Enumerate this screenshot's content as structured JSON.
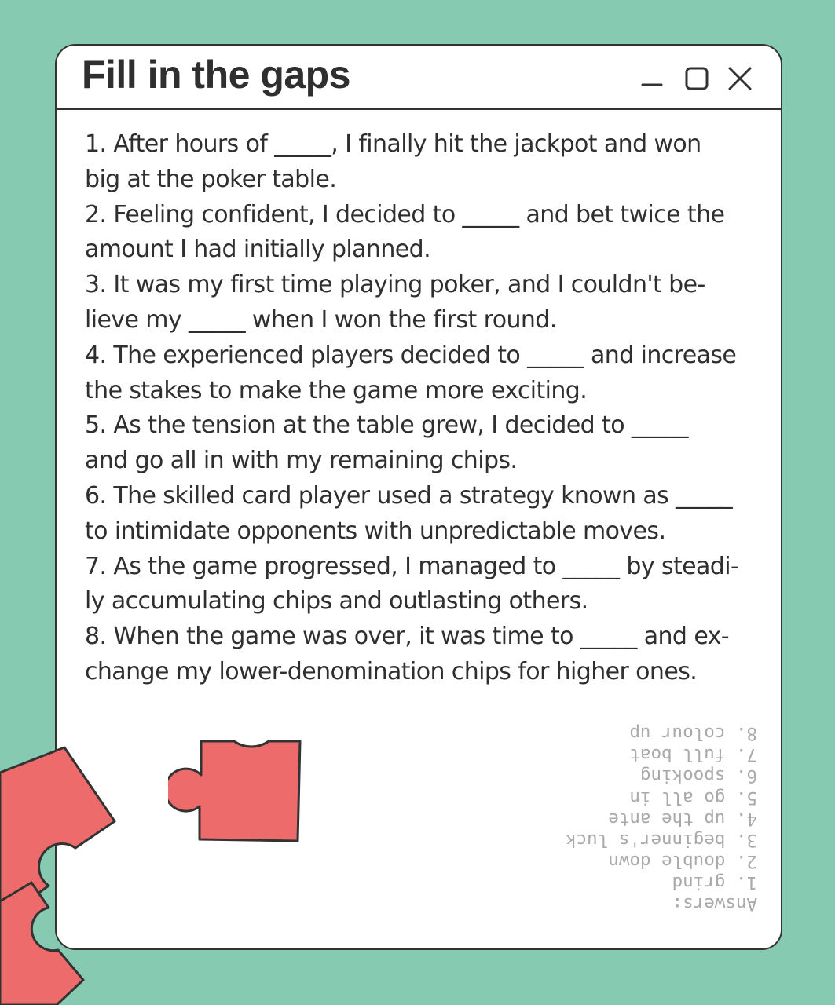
{
  "window": {
    "title": "Fill in the gaps",
    "controls": [
      "minimize-icon",
      "maximize-icon",
      "close-icon"
    ]
  },
  "exercise": {
    "lines": [
      "1. After hours of _____, I finally hit the jackpot and won",
      "big at the poker table.",
      "2. Feeling confident, I decided to _____ and bet twice the",
      "amount I had initially planned.",
      "3. It was my first time playing poker, and I couldn't be-",
      "lieve my _____ when I won the first round.",
      "4. The experienced players decided to _____ and increase",
      "the stakes to make the game more exciting.",
      "5. As the tension at the table grew, I decided to _____",
      "and go all in with my remaining chips.",
      "6. The skilled card player used a strategy known as _____",
      "to intimidate opponents with unpredictable moves.",
      "7. As the game progressed, I managed to _____ by steadi-",
      "ly accumulating chips and outlasting others.",
      "8. When the game was over, it was time to _____ and ex-",
      "change my lower-denomination chips for higher ones."
    ]
  },
  "answers": {
    "heading": "Answers:",
    "items": [
      "1. grind",
      "2. double down",
      "3. beginner's luck",
      "4. up the ante",
      "5. go all in",
      "6. spooking",
      "7. full boat",
      "8. colour up"
    ]
  },
  "colors": {
    "background": "#86cbb1",
    "window": "#ffffff",
    "outline": "#333333",
    "puzzle": "#ed6b6b",
    "answers_text": "#a9a9a9"
  },
  "decorations": [
    "puzzle-piece-icon",
    "puzzle-piece-icon",
    "puzzle-piece-icon"
  ]
}
